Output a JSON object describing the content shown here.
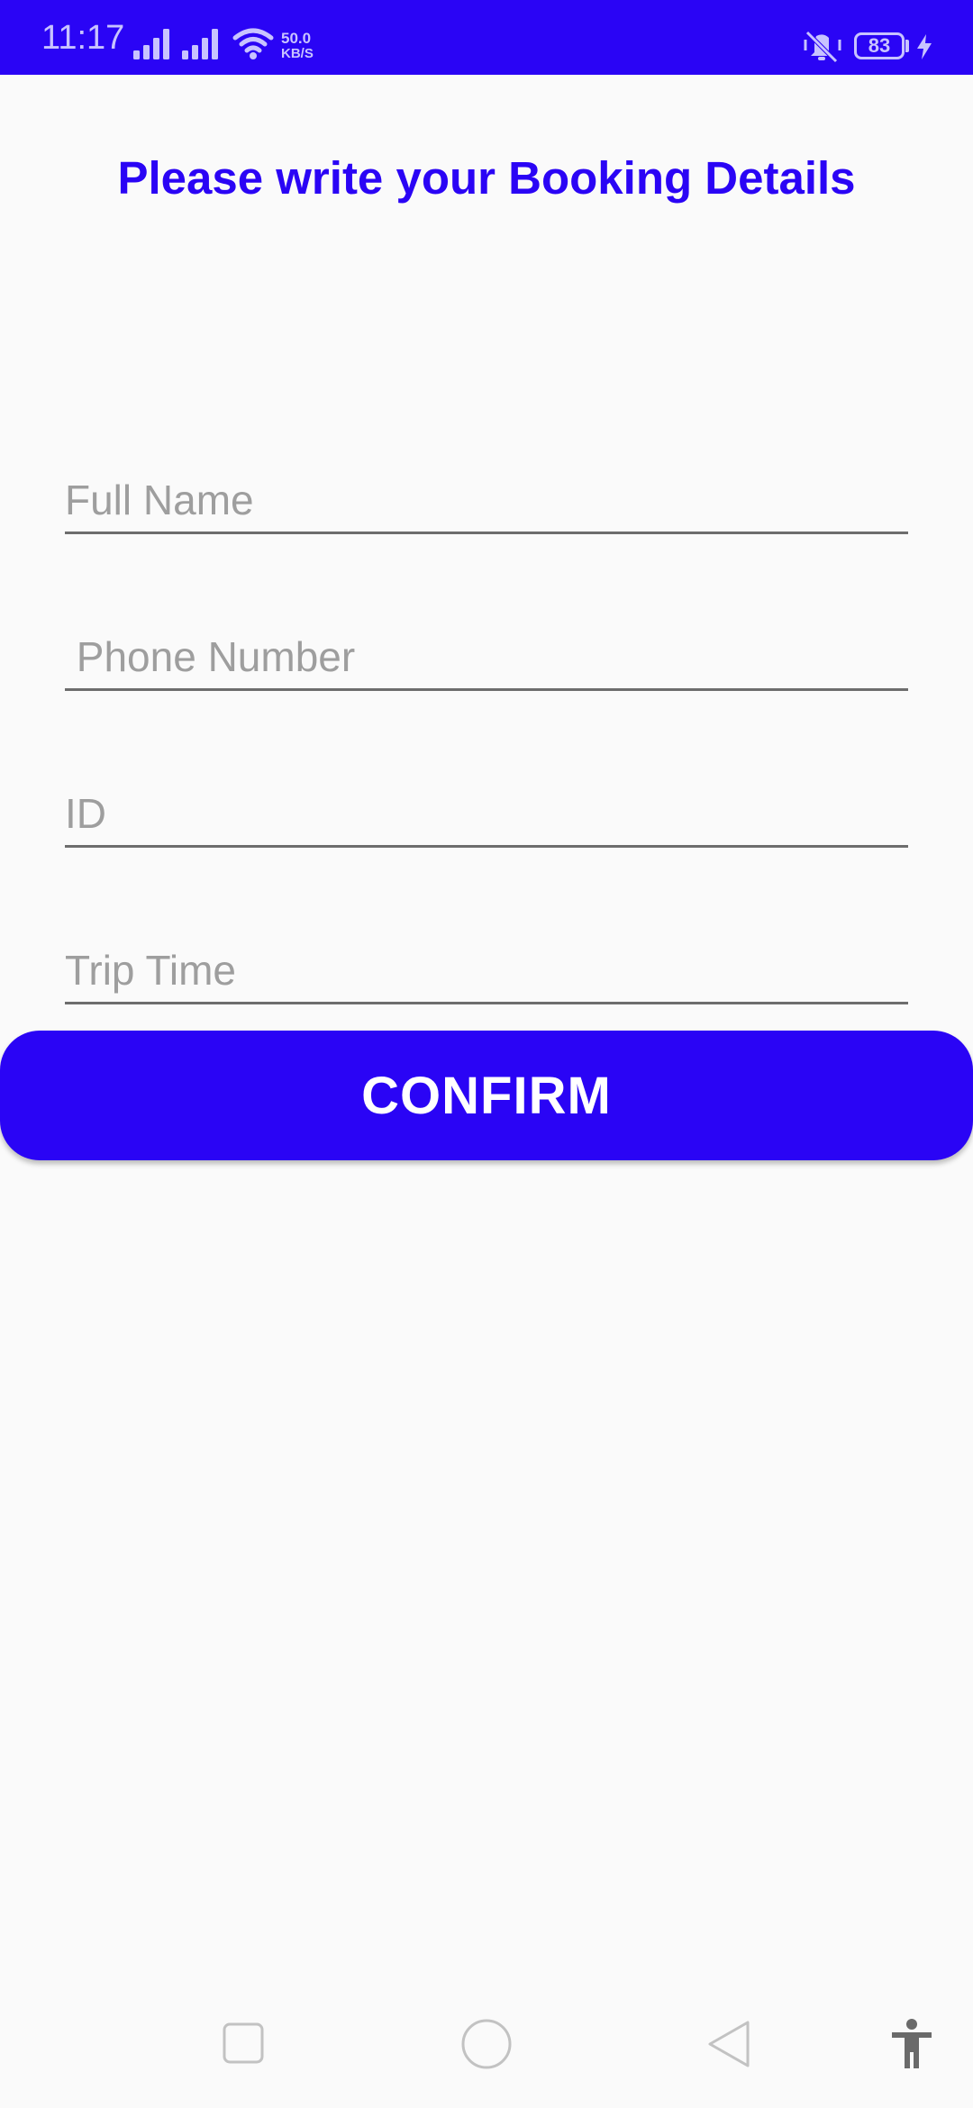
{
  "status_bar": {
    "time": "11:17",
    "network_speed": "50.0",
    "network_speed_unit": "KB/S",
    "battery_level": "83",
    "background_color": "#2a04f5",
    "icons": [
      "signal-icon",
      "signal-icon",
      "wifi-icon",
      "mute-icon",
      "battery-icon",
      "charging-icon"
    ]
  },
  "header": {
    "title": "Please write your Booking Details",
    "color": "#2a04f5"
  },
  "form": {
    "full_name": {
      "value": "",
      "placeholder": "Full Name"
    },
    "phone_number": {
      "value": "",
      "placeholder": " Phone Number"
    },
    "id": {
      "value": "",
      "placeholder": "ID"
    },
    "trip_time": {
      "value": "",
      "placeholder": "Trip Time"
    }
  },
  "actions": {
    "confirm_label": "CONFIRM",
    "confirm_color": "#2a04f5"
  },
  "nav_bar": {
    "icons": [
      "recents-icon",
      "home-icon",
      "back-icon",
      "accessibility-icon"
    ]
  }
}
